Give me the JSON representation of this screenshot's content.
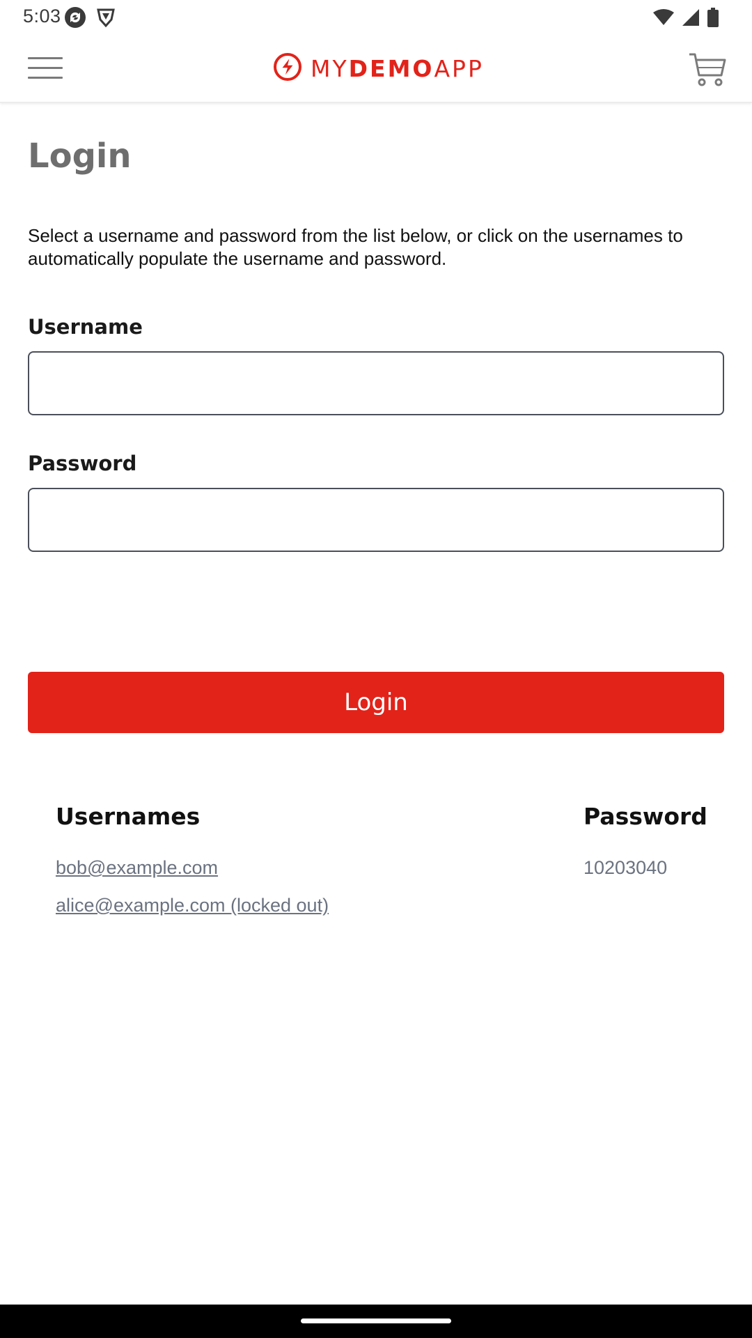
{
  "status_bar": {
    "time": "5:03",
    "left_icons": [
      "sync-icon",
      "shield-icon"
    ],
    "right_icons": [
      "wifi-icon",
      "signal-icon",
      "battery-icon"
    ]
  },
  "header": {
    "menu_icon": "hamburger-menu-icon",
    "logo": {
      "icon": "lightning-bolt-logo-icon",
      "text_thin_1": "MY",
      "text_bold": "DEMO",
      "text_thin_2": "APP"
    },
    "cart_icon": "shopping-cart-icon"
  },
  "main": {
    "title": "Login",
    "description": "Select a username and password from the list below, or click on the usernames to automatically populate the username and password.",
    "username_label": "Username",
    "username_value": "",
    "password_label": "Password",
    "password_value": "",
    "login_button": "Login"
  },
  "credentials": {
    "usernames_header": "Usernames",
    "password_header": "Password",
    "usernames": [
      "bob@example.com",
      "alice@example.com (locked out)"
    ],
    "password": "10203040"
  },
  "colors": {
    "brand_red": "#e2231a",
    "title_gray": "#6e6e6e",
    "link_gray": "#6b7280"
  }
}
